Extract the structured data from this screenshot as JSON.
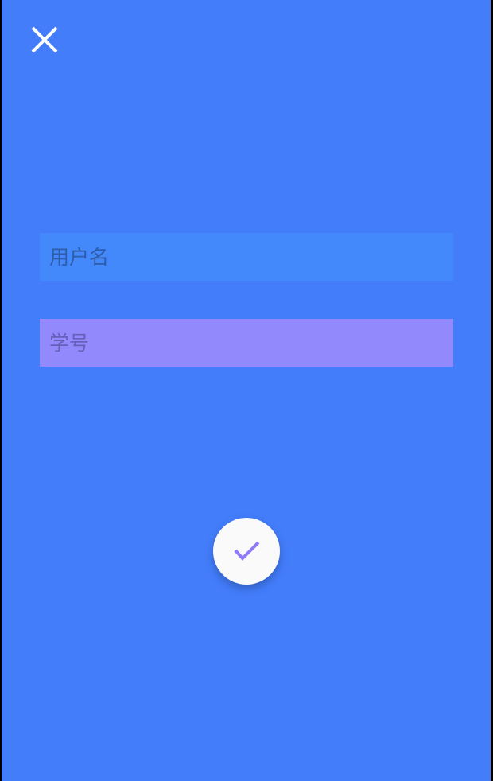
{
  "header": {
    "close_icon": "close-icon"
  },
  "form": {
    "username": {
      "value": "",
      "placeholder": "用户名"
    },
    "student_id": {
      "value": "",
      "placeholder": "学号"
    }
  },
  "confirm": {
    "icon": "check-icon"
  },
  "colors": {
    "background": "#437DFA",
    "username_field": "#4389FC",
    "student_field": "#9189FC",
    "button_bg": "#FAFAFB",
    "check_color": "#8F7BF8"
  }
}
